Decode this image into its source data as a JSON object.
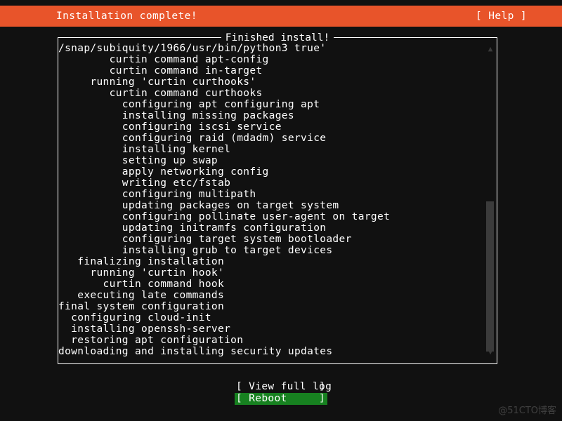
{
  "header": {
    "title": "Installation complete!",
    "help_label": "[ Help ]",
    "background_color": "#e8542a",
    "text_color": "#ffffff"
  },
  "log_panel": {
    "frame_title": "Finished install!",
    "lines": [
      "/snap/subiquity/1966/usr/bin/python3 true'",
      "        curtin command apt-config",
      "        curtin command in-target",
      "     running 'curtin curthooks'",
      "        curtin command curthooks",
      "          configuring apt configuring apt",
      "          installing missing packages",
      "          configuring iscsi service",
      "          configuring raid (mdadm) service",
      "          installing kernel",
      "          setting up swap",
      "          apply networking config",
      "          writing etc/fstab",
      "          configuring multipath",
      "          updating packages on target system",
      "          configuring pollinate user-agent on target",
      "          updating initramfs configuration",
      "          configuring target system bootloader",
      "          installing grub to target devices",
      "   finalizing installation",
      "     running 'curtin hook'",
      "       curtin command hook",
      "   executing late commands",
      "final system configuration",
      "  configuring cloud-init",
      "  installing openssh-server",
      "  restoring apt configuration",
      "downloading and installing security updates"
    ]
  },
  "scrollbar": {
    "up_arrow": "▲",
    "down_arrow": "▼",
    "thumb_color": "#3b3b3b",
    "arrow_color": "#3a3a3a"
  },
  "buttons": [
    {
      "label": "View full log",
      "bracket_left": "[",
      "bracket_right": "]",
      "selected": false
    },
    {
      "label": "Reboot",
      "bracket_left": "[",
      "bracket_right": "]",
      "selected": true,
      "highlight_color": "#178120"
    }
  ],
  "watermark": {
    "text": "@51CTO博客"
  }
}
